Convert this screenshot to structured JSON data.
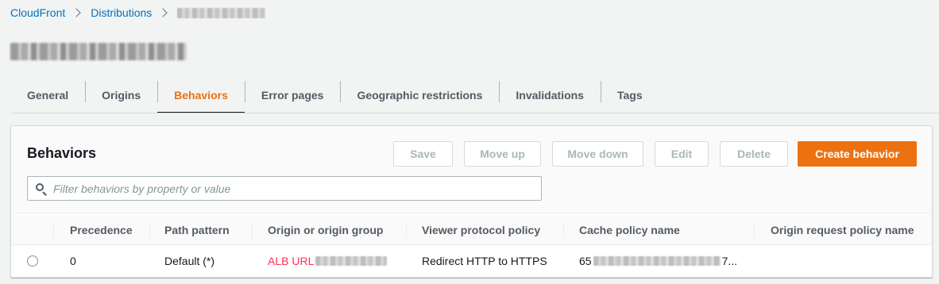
{
  "breadcrumb": {
    "items": [
      "CloudFront",
      "Distributions"
    ]
  },
  "tabs": [
    "General",
    "Origins",
    "Behaviors",
    "Error pages",
    "Geographic restrictions",
    "Invalidations",
    "Tags"
  ],
  "active_tab": "Behaviors",
  "panel": {
    "title": "Behaviors",
    "buttons": {
      "save": "Save",
      "move_up": "Move up",
      "move_down": "Move down",
      "edit": "Edit",
      "delete": "Delete",
      "create": "Create behavior"
    },
    "search": {
      "placeholder": "Filter behaviors by property or value",
      "value": ""
    }
  },
  "table": {
    "columns": [
      "Precedence",
      "Path pattern",
      "Origin or origin group",
      "Viewer protocol policy",
      "Cache policy name",
      "Origin request policy name"
    ],
    "rows": [
      {
        "precedence": "0",
        "path_pattern": "Default (*)",
        "origin_visible": "ALB URL",
        "viewer_protocol_policy": "Redirect HTTP to HTTPS",
        "cache_policy_prefix": "65",
        "cache_policy_suffix": "7...",
        "origin_request_policy": ""
      }
    ]
  },
  "colors": {
    "accent": "#ec7211",
    "link": "#0073bb",
    "annotation": "#ff2d55"
  }
}
